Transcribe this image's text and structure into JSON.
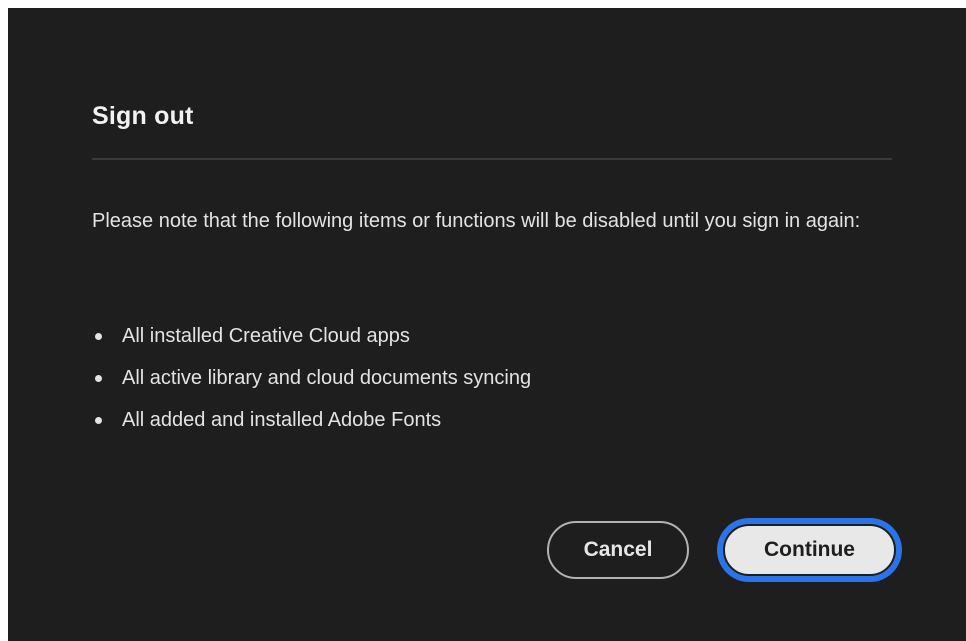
{
  "dialog": {
    "title": "Sign out",
    "message": "Please note that the following items or functions will be disabled until you sign in again:",
    "items": [
      "All installed Creative Cloud apps",
      "All active library and cloud documents syncing",
      "All added and installed Adobe Fonts"
    ],
    "buttons": {
      "cancel_label": "Cancel",
      "continue_label": "Continue"
    }
  },
  "colors": {
    "background": "#1e1e1e",
    "focus_ring": "#2b74e8",
    "primary_button": "#e8e8e8"
  }
}
